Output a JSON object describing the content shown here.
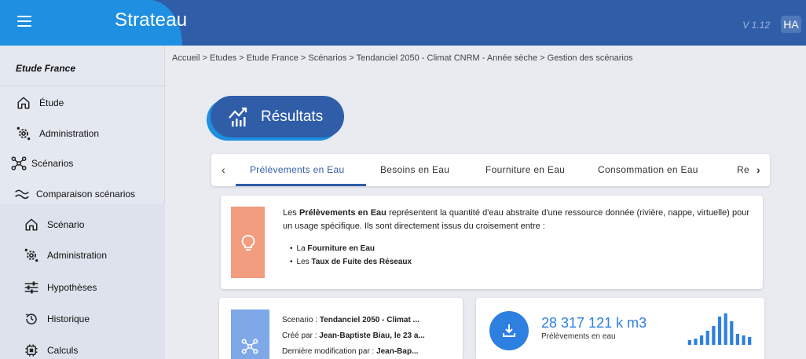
{
  "header": {
    "app_title": "Strateau",
    "version": "V 1.12",
    "avatar": "HA",
    "accent_color": "#2f5da8",
    "brand_color": "#1e8fe1"
  },
  "sidebar": {
    "study_title": "Etude France",
    "items": [
      {
        "label": "Étude",
        "icon": "home-icon"
      },
      {
        "label": "Administration",
        "icon": "gears-icon"
      },
      {
        "label": "Scénarios",
        "icon": "scenarios-graph-icon"
      },
      {
        "label": "Comparaison scénarios",
        "icon": "compare-wave-icon"
      }
    ],
    "sub_items": [
      {
        "label": "Scénario",
        "icon": "home-icon"
      },
      {
        "label": "Administration",
        "icon": "gears-icon"
      },
      {
        "label": "Hypothèses",
        "icon": "sliders-icon"
      },
      {
        "label": "Historique",
        "icon": "history-icon"
      },
      {
        "label": "Calculs",
        "icon": "calculator-chip-icon"
      }
    ]
  },
  "breadcrumb": "Accueil > Etudes > Etude France > Scénarios > Tendanciel 2050 - Climat CNRM - Année sèche > Gestion des scénarios",
  "results": {
    "label": "Résultats",
    "icon": "chart-icon"
  },
  "tabs": {
    "prev": "‹",
    "next": "›",
    "items": [
      {
        "label": "Prélèvements en Eau",
        "active": true
      },
      {
        "label": "Besoins en Eau",
        "active": false
      },
      {
        "label": "Fourniture en Eau",
        "active": false
      },
      {
        "label": "Consommation en Eau",
        "active": false
      },
      {
        "label": "Re",
        "active": false
      }
    ]
  },
  "info": {
    "icon": "lightbulb-icon",
    "p1": "Les ",
    "p1_bold": "Prélèvements en Eau",
    "p1_rest": " représentent la quantité d'eau abstraite d'une ressource donnée (rivière, nappe, virtuelle) pour un usage spécifique. Ils sont directement issus du croisement entre :",
    "bullet1_prefix": "La ",
    "bullet1_bold": "Fourniture en Eau",
    "bullet2_prefix": "Les ",
    "bullet2_bold": "Taux de Fuite des Réseaux",
    "stripe_color": "#f29d7f"
  },
  "meta": {
    "icon": "scenarios-graph-icon",
    "scenario_label": "Scenario : ",
    "scenario_value": "Tendanciel 2050 - Climat ...",
    "created_label": "Créé par : ",
    "created_value": "Jean-Baptiste Biau, le 23 a...",
    "modified_label": "Dernière modification par : ",
    "modified_value": "Jean-Bap...",
    "stripe_color": "#7ea8e8"
  },
  "kpi": {
    "icon": "download-icon",
    "value": "28 317 121 k m3",
    "label": "Prélèvements en eau",
    "color": "#2d7fe0",
    "sparkline": [
      3,
      4,
      6,
      9,
      12,
      18,
      20,
      15,
      7,
      6,
      5
    ]
  }
}
